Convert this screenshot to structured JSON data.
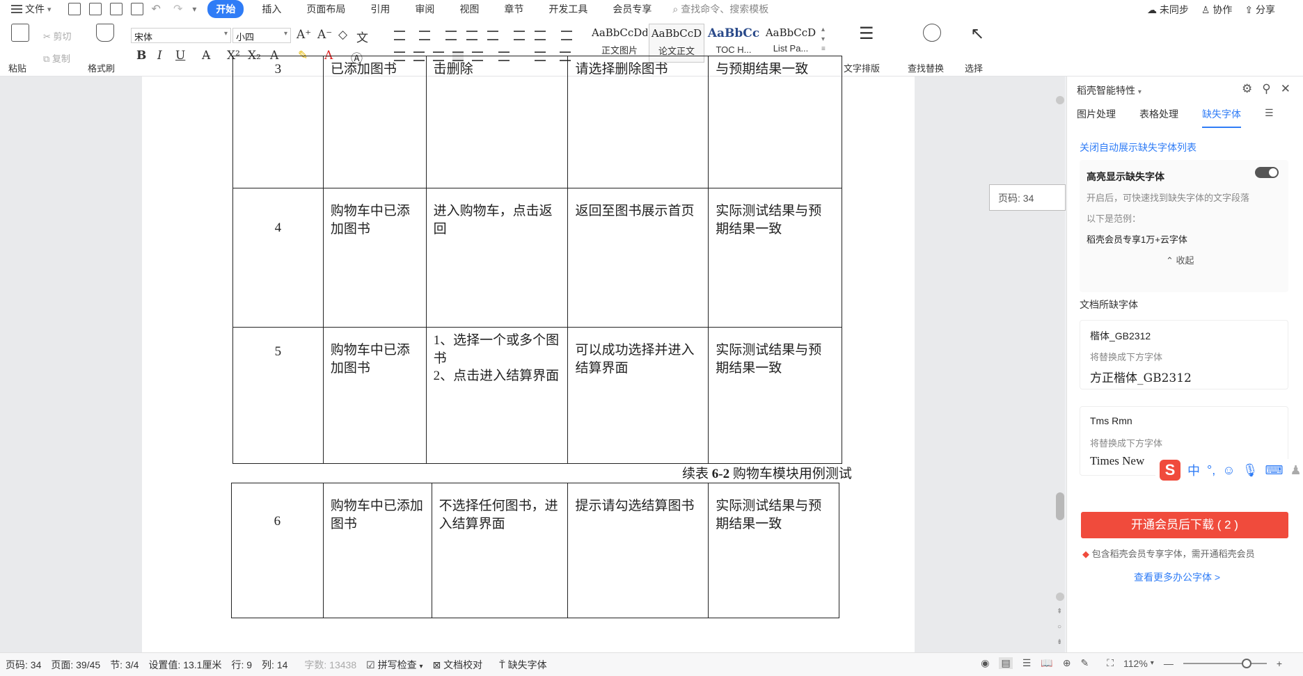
{
  "menubar": {
    "file_label": "文件",
    "tabs": [
      "开始",
      "插入",
      "页面布局",
      "引用",
      "审阅",
      "视图",
      "章节",
      "开发工具",
      "会员专享"
    ],
    "active_tab": "开始",
    "search_placeholder": "查找命令、搜索模板",
    "right": {
      "sync": "未同步",
      "collab": "协作",
      "share": "分享"
    }
  },
  "ribbon": {
    "paste": "粘贴",
    "cut": "剪切",
    "copy": "复制",
    "format_painter": "格式刷",
    "font_name": "宋体",
    "font_size": "小四",
    "styles": [
      {
        "sample": "AaBbCcDd",
        "name": "正文图片"
      },
      {
        "sample": "AaBbCcD",
        "name": "论文正文"
      },
      {
        "sample": "AaBbCc",
        "name": "TOC H..."
      },
      {
        "sample": "AaBbCcD",
        "name": "List Pa..."
      }
    ],
    "text_layout": "文字排版",
    "find_replace": "查找替换",
    "select": "选择"
  },
  "document": {
    "table1_rows": [
      {
        "num": "3",
        "c1": "已添加图书",
        "c2": "击删除",
        "c3": "请选择删除图书",
        "c4": "与预期结果一致"
      },
      {
        "num": "4",
        "c1": "购物车中已添加图书",
        "c2": "进入购物车，点击返回",
        "c3": "返回至图书展示首页",
        "c4": "实际测试结果与预期结果一致"
      },
      {
        "num": "5",
        "c1": "购物车中已添加图书",
        "c2": "1、选择一个或多个图书\n2、点击进入结算界面",
        "c3": "可以成功选择并进入结算界面",
        "c4": "实际测试结果与预期结果一致"
      }
    ],
    "caption_prefix": "续表",
    "caption_num": "6-2",
    "caption_text": "购物车模块用例测试",
    "table2_rows": [
      {
        "num": "6",
        "c1": "购物车中已添加图书",
        "c2": "不选择任何图书，进入结算界面",
        "c3": "提示请勾选结算图书",
        "c4": "实际测试结果与预期结果一致"
      }
    ],
    "page_tip": "页码: 34"
  },
  "panel": {
    "title": "稻壳智能特性",
    "tabs": [
      "图片处理",
      "表格处理",
      "缺失字体"
    ],
    "active_tab": "缺失字体",
    "close_auto_link": "关闭自动展示缺失字体列表",
    "highlight_title": "高亮显示缺失字体",
    "highlight_desc": "开启后，可快速找到缺失字体的文字段落",
    "example_label": "以下是范例：",
    "example_text": "稻壳会员专享1万+云字体",
    "collapse": "收起",
    "missing_section": "文档所缺字体",
    "fonts": [
      {
        "name": "楷体_GB2312",
        "hint": "将替换成下方字体",
        "replacement": "方正楷体_GB2312"
      },
      {
        "name": "Tms Rmn",
        "hint": "将替换成下方字体",
        "replacement": "Times New"
      }
    ],
    "cta": "开通会员后下载 ( 2 )",
    "member_note": "包含稻壳会员专享字体，需开通稻壳会员",
    "more_link": "查看更多办公字体 >"
  },
  "ime": {
    "mode": "中",
    "punct": "°,"
  },
  "statusbar": {
    "page_code": "页码: 34",
    "page": "页面: 39/45",
    "section": "节: 3/4",
    "setting": "设置值: 13.1厘米",
    "row": "行: 9",
    "col": "列: 14",
    "word_count": "字数: 13438",
    "spell": "拼写检查",
    "proof": "文档校对",
    "missing_font": "缺失字体",
    "zoom": "112%",
    "zoom_level": 0.62
  },
  "colors": {
    "accent": "#2f7cf6",
    "cta": "#f04b3c"
  }
}
